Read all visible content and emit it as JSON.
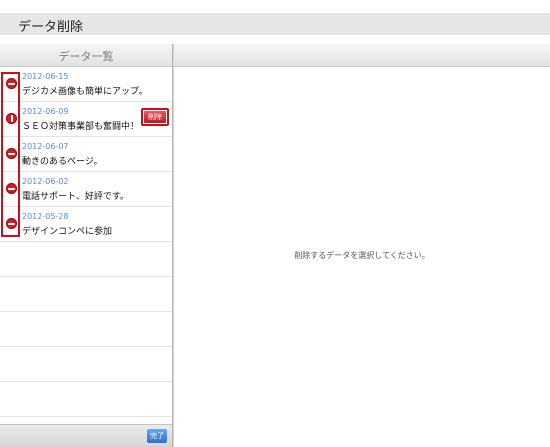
{
  "page": {
    "title": "データ削除"
  },
  "sidebar": {
    "title": "データ一覧",
    "items": [
      {
        "date": "2012-06-15",
        "text": "デジカメ画像も簡単にアップ。"
      },
      {
        "date": "2012-06-09",
        "text": "ＳＥＯ対策事業部も奮闘中！"
      },
      {
        "date": "2012-06-07",
        "text": "動きのあるページ。"
      },
      {
        "date": "2012-06-02",
        "text": "電話サポート、好評です。"
      },
      {
        "date": "2012-05-28",
        "text": "デザインコンペに参加"
      }
    ],
    "delete_label": "削除",
    "done_label": "完了"
  },
  "main": {
    "message": "削除するデータを選択してください。"
  },
  "colors": {
    "accent_red": "#c2121a",
    "date_blue": "#5b8cd8"
  },
  "icons": {
    "delete": "minus-circle-icon",
    "confirm_delete": "rotated-minus-icon"
  }
}
